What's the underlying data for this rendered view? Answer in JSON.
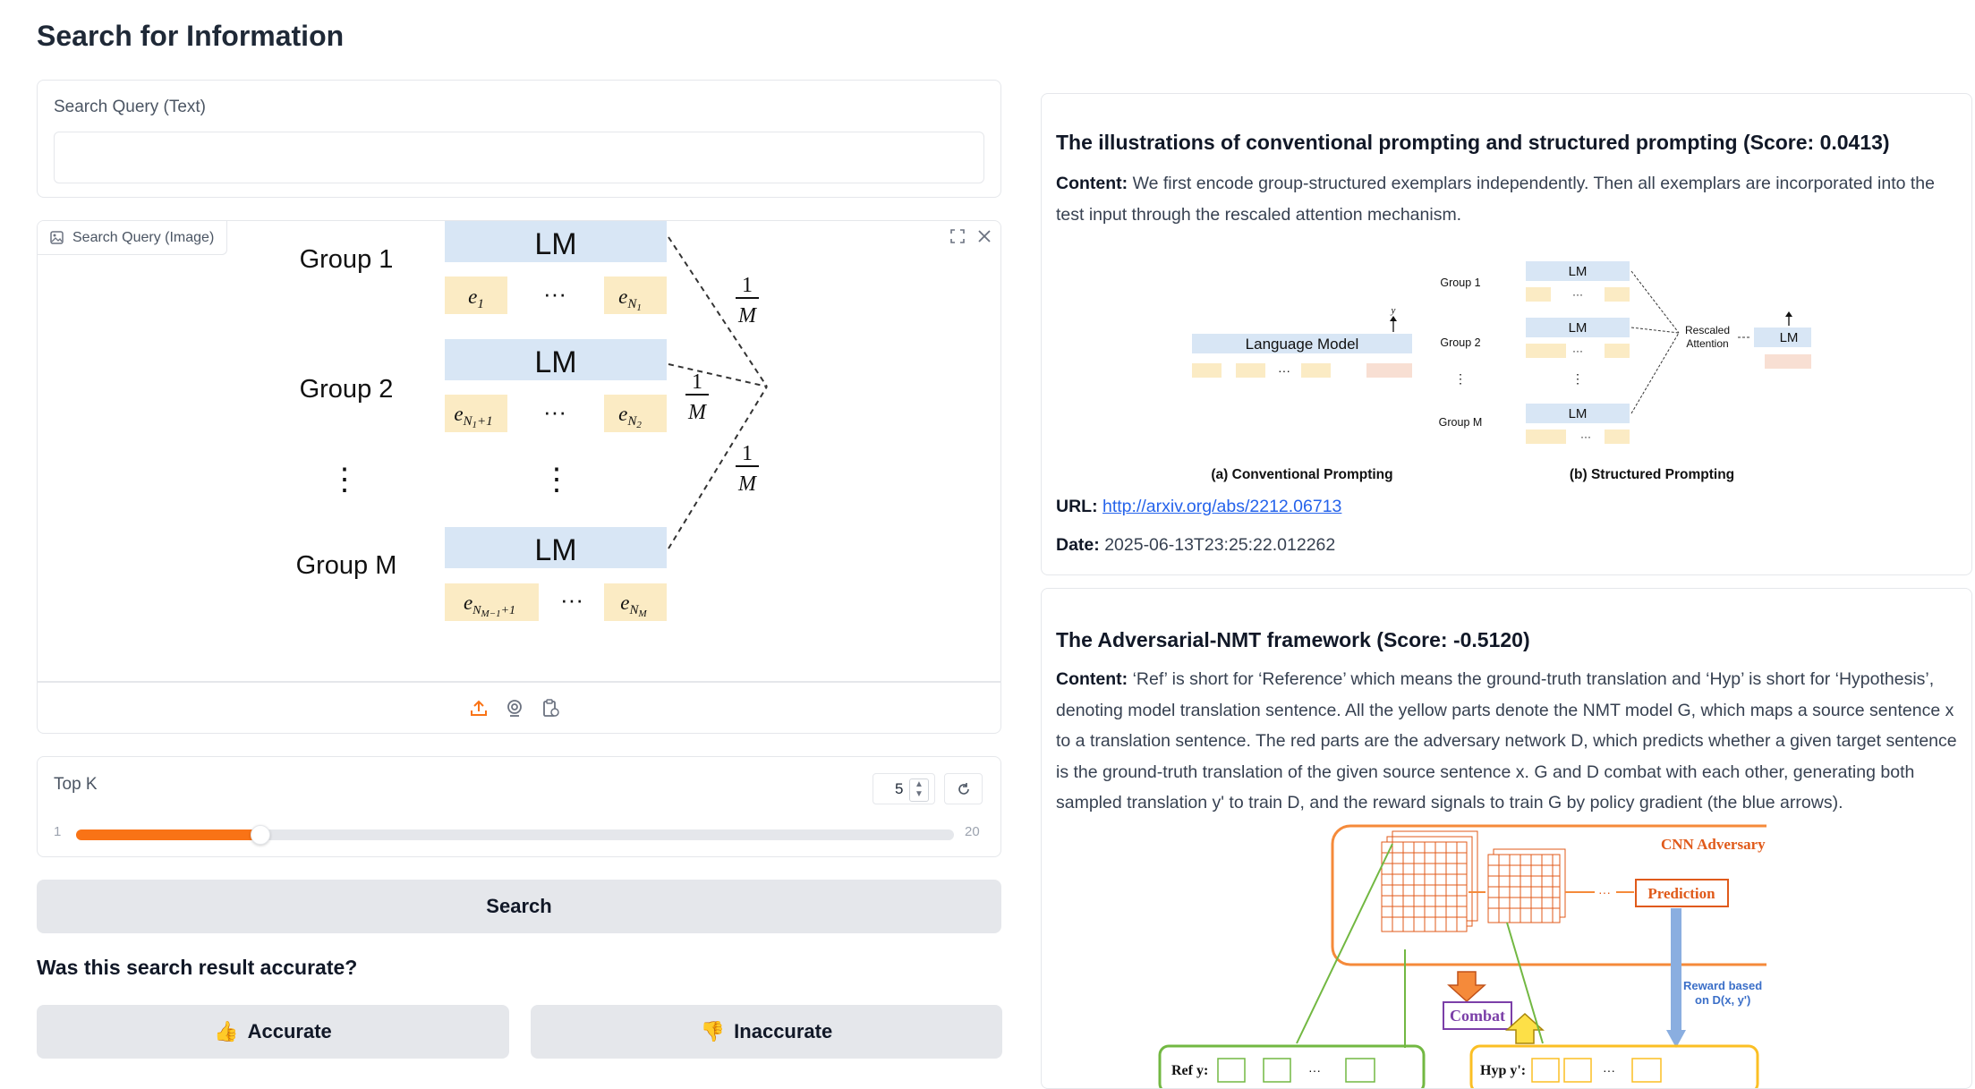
{
  "page": {
    "title": "Search for Information"
  },
  "search": {
    "text_label": "Search Query (Text)",
    "text_value": "",
    "text_placeholder": "",
    "image_label": "Search Query (Image)",
    "topk_label": "Top K",
    "topk_value": "5",
    "topk_min": "1",
    "topk_max": "20",
    "topk_fraction": 0.21,
    "search_label": "Search"
  },
  "query_figure": {
    "groups": [
      "Group 1",
      "Group 2",
      "Group M"
    ],
    "lm": "LM",
    "dots": "⋮",
    "ellipsis": "···"
  },
  "feedback": {
    "question": "Was this search result accurate?",
    "accurate_label": "Accurate",
    "inaccurate_label": "Inaccurate",
    "accurate_emoji": "👍",
    "inaccurate_emoji": "👎"
  },
  "results": [
    {
      "title": "The illustrations of conventional prompting and structured prompting (Score: 0.0413)",
      "content_prefix": "Content:",
      "content": "We first encode group-structured exemplars independently. Then all exemplars are incorporated into the test input through the rescaled attention mechanism.",
      "url_label": "URL:",
      "url": "http://arxiv.org/abs/2212.06713",
      "date_label": "Date:",
      "date": "2025-06-13T23:25:22.012262",
      "figure": {
        "caption_a": "(a) Conventional Prompting",
        "caption_b": "(b) Structured Prompting",
        "language_model": "Language Model",
        "rescaled": "Rescaled",
        "attention": "Attention",
        "group1": "Group 1",
        "group2": "Group 2",
        "groupm": "Group M",
        "lm": "LM"
      }
    },
    {
      "title": "The Adversarial-NMT framework (Score: -0.5120)",
      "content_prefix": "Content:",
      "content": "‘Ref’ is short for ‘Reference’ which means the ground-truth translation and ‘Hyp’ is short for ‘Hypothesis’, denoting model translation sentence. All the yellow parts denote the NMT model G, which maps a source sentence x to a translation sentence. The red parts are the adversary network D, which predicts whether a given target sentence is the ground-truth translation of the given source sentence x. G and D combat with each other, generating both sampled translation y' to train D, and the reward signals to train G by policy gradient (the blue arrows).",
      "figure": {
        "cnn": "CNN Adversary D",
        "prediction": "Prediction",
        "combat": "Combat",
        "reward1": "Reward based",
        "reward2": "on D(x, y')",
        "ref": "Ref y:",
        "hyp": "Hyp y':"
      }
    }
  ]
}
